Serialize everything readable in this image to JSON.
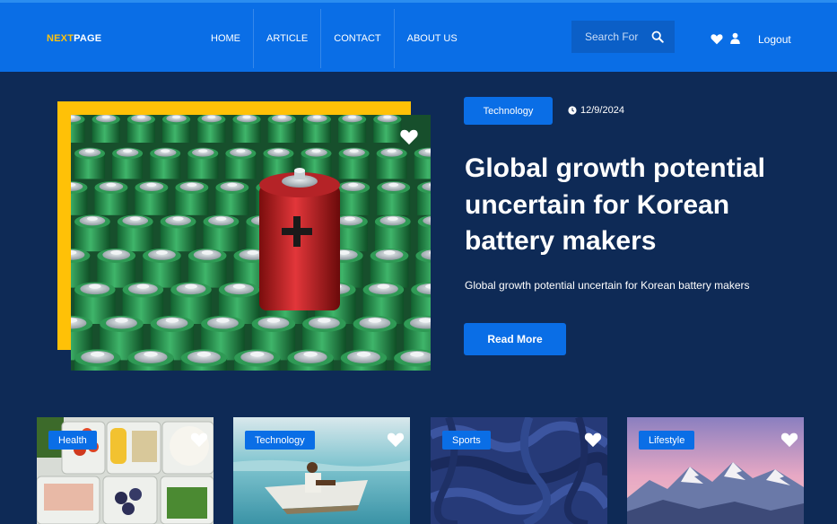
{
  "navbar": {
    "logo_part1": "NEXT",
    "logo_part2": "PAGE",
    "links": [
      "HOME",
      "ARTICLE",
      "CONTACT",
      "ABOUT US"
    ],
    "search_placeholder": "Search For",
    "logout_label": "Logout"
  },
  "hero": {
    "category": "Technology",
    "date": "12/9/2024",
    "title": "Global growth potential uncertain for Korean battery makers",
    "description": "Global growth potential uncertain for Korean battery makers",
    "read_more_label": "Read More"
  },
  "cards": [
    {
      "category": "Health"
    },
    {
      "category": "Technology"
    },
    {
      "category": "Sports"
    },
    {
      "category": "Lifestyle"
    }
  ],
  "colors": {
    "background": "#0e2a56",
    "navbar": "#0a6ee6",
    "accent_yellow": "#ffc107",
    "button": "#0a6ee6"
  }
}
